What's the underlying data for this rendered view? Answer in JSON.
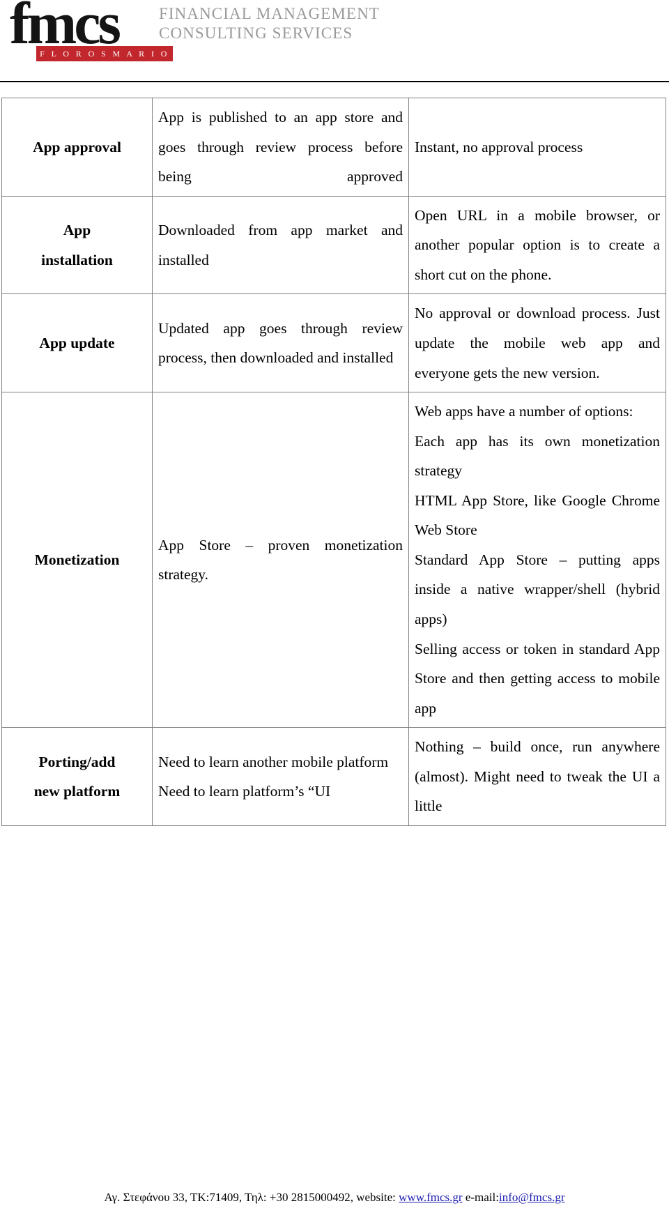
{
  "header": {
    "logo_word": "fmcs",
    "logo_banner": "F L O R O S   M A R I O S",
    "tagline_line1": "FINANCIAL MANAGEMENT",
    "tagline_line2": "CONSULTING SERVICES",
    "accent_color": "#c1272d",
    "tagline_color": "#9a9a9a"
  },
  "table": {
    "rows": [
      {
        "label": "App approval",
        "native": "App is published to an app store and goes through review process before being approved",
        "web": "Instant, no approval process"
      },
      {
        "label_line1": "App",
        "label_line2": "installation",
        "label": "App installation",
        "native": "Downloaded from app market and installed",
        "web": "Open URL in a mobile browser, or another popular option is to create a short cut on the phone."
      },
      {
        "label": "App update",
        "native": "Updated app goes through review process, then downloaded and installed",
        "web": "No approval or download process. Just update the mobile web app and everyone gets the new version."
      },
      {
        "label": "Monetization",
        "native": "App Store – proven monetization strategy.",
        "web_intro": "Web apps have a number of options:",
        "web_items": [
          "Each app has its own monetization strategy",
          "HTML App Store, like Google Chrome Web Store",
          "Standard App Store – putting apps inside a native wrapper/shell (hybrid apps)",
          "Selling access or token in standard App Store and then getting access to mobile app"
        ]
      },
      {
        "label_line1": "Porting/add",
        "label_line2": "new platform",
        "label": "Porting/add new platform",
        "native_line1": "Need to learn another mobile platform",
        "native_line2": "Need to learn platform’s “UI",
        "web": "Nothing – build once, run anywhere (almost). Might need to tweak the UI a little"
      }
    ]
  },
  "footer": {
    "address": "Αγ. Στεφάνου 33, ΤΚ:71409, Τηλ: +30 2815000492, website:",
    "website": "www.fmcs.gr",
    "email_label": "e-mail:",
    "email": "info@fmcs.gr",
    "link_color": "#1a1ab0"
  }
}
